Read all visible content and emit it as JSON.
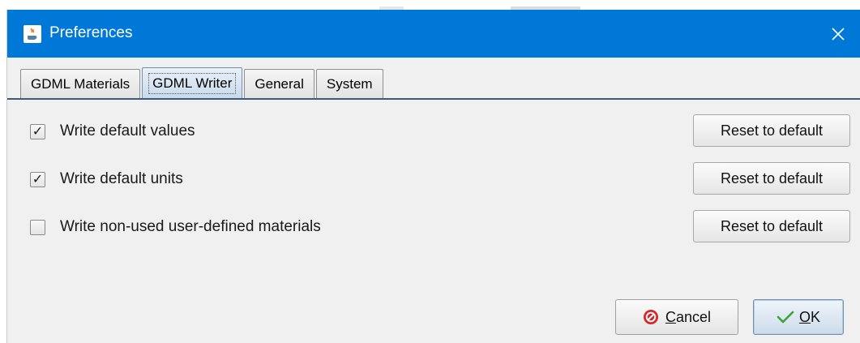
{
  "window": {
    "title": "Preferences",
    "app_icon": "java-cup-icon",
    "close_icon": "close-icon"
  },
  "tabs": [
    {
      "label": "GDML Materials",
      "active": false
    },
    {
      "label": "GDML Writer",
      "active": true
    },
    {
      "label": "General",
      "active": false
    },
    {
      "label": "System",
      "active": false
    }
  ],
  "options": [
    {
      "label": "Write default values",
      "checked": true,
      "reset_label": "Reset to default"
    },
    {
      "label": "Write default units",
      "checked": true,
      "reset_label": "Reset to default"
    },
    {
      "label": "Write non-used user-defined materials",
      "checked": false,
      "reset_label": "Reset to default"
    }
  ],
  "footer": {
    "cancel_mnemonic": "C",
    "cancel_rest": "ancel",
    "cancel_icon": "cancel-icon",
    "ok_mnemonic": "O",
    "ok_rest": "K",
    "ok_icon": "checkmark-icon"
  },
  "colors": {
    "titlebar": "#0078d7",
    "window_bg": "#f0f0f0",
    "active_tab": "#c8daec",
    "cancel_icon_red": "#d9262b",
    "ok_icon_green": "#3aa33a"
  }
}
